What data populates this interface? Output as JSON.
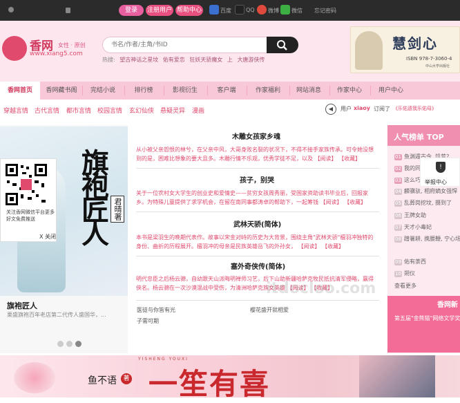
{
  "topbar": {
    "username_placeholder": "",
    "password_placeholder": "",
    "login_label": "登录",
    "register_label": "注册用户",
    "help_label": "帮助中心",
    "baidu_label": "百度",
    "qq_label": "QQ",
    "weibo_label": "微博",
    "wechat_label": "微信",
    "forgot_label": "忘记密码"
  },
  "header": {
    "logo_name": "香网",
    "logo_sub": "女性 · 原创",
    "logo_url": "www.xiang5.com",
    "search_placeholder": "书名/作者/主角/书ID",
    "hot_label": "热搜:",
    "hot_terms": [
      "望古神话之星坟",
      "佑有爱恋",
      "狂妖天骄魔女",
      "上",
      "大唐游侠传"
    ],
    "ad_title": "慧剑心",
    "ad_isbn": "ISBN 978-7-3060-4",
    "ad_publisher": "中山大学出版社"
  },
  "nav": {
    "items": [
      "香网首页",
      "香网藏书阁",
      "完结小说",
      "排行榜",
      "影视衍生",
      "客户端",
      "作家福利",
      "网站消息",
      "作家中心",
      "用户中心"
    ]
  },
  "subnav": {
    "items": [
      "穿越言情",
      "古代言情",
      "都市言情",
      "校园言情",
      "玄幻仙侠",
      "悬疑灵异",
      "漫画"
    ],
    "user_label": "用户",
    "user_name": "xiaoy",
    "subscribed_label": "订阅了",
    "subscribed_book": "《乐佑遗我乐佑母》"
  },
  "showcase": {
    "cover_title": "旗袍匠人",
    "cover_author": "君晴著",
    "qr_caption": "关注香网微信平台更多好文免费推送",
    "qr_close": "X 关闭",
    "book_name": "旗袍匠人",
    "book_desc": "栗盛旗袍百年老店第二代传人盛国华，..."
  },
  "list": [
    {
      "title": "木雕女孩家乡魂",
      "desc": "从小被父亲怨恨的林兮，在父亲中风，大哥身败名裂的状况下，不得不接手家族传承。可令她没想到的是，困难比想象的要大且多。木雕行情不乐观，优秀学徒不足，以及",
      "read": "【阅读】",
      "fav": "【收藏】"
    },
    {
      "title": "孩子，别哭",
      "desc": "关于一位农村女大学生的创业史和爱情史——贫穷女孩周秀丽，受国家资助读书毕业后，回报家乡。为特殊儿童提供了求学机会，在留在南同事都涛卓的帮助下，一起筹钱",
      "read": "【阅读】",
      "fav": "【收藏】"
    },
    {
      "title": "武林天骄(简体)",
      "desc": "本书是梁羽生的晚期代表作。故事以宋金对峙的历史为大背景，围绕主角\"武林天骄\"檀羽冲独特的身份、曲折的历程展开。檀羽冲的母亲是民族英雄岳飞的外孙女，",
      "read": "【阅读】",
      "fav": "【收藏】"
    },
    {
      "title": "塞外奇侠传(简体)",
      "desc": "明代忠臣之后杨云骢，自幼跟天山派晦明禅师习艺，后下山助新疆哈萨克牧民抵抗清军侵略，赢得侠名。杨云骢在一次沙漠混战中受伤，为清洲哈萨克族女英雄",
      "read": "【阅读】",
      "fav": "【收藏】"
    }
  ],
  "minilinks": [
    "医徒与你皆有光",
    "樱花盛开就相爱",
    "子需可期"
  ],
  "rank": {
    "title": "人气榜单 TOP",
    "report_label": "举报中心",
    "items": [
      {
        "n": "01",
        "t": "鱼渊遁古今, 饥荒?"
      },
      {
        "n": "02",
        "t": "我的同事都"
      },
      {
        "n": "03",
        "t": "这么巧, 我"
      },
      {
        "n": "04",
        "t": "麟骥驮, 相府嫡女强悍"
      },
      {
        "n": "05",
        "t": "乱葬岗挖坟, 摄到了"
      },
      {
        "n": "06",
        "t": "王牌女助"
      },
      {
        "n": "07",
        "t": "天才小毒妃"
      },
      {
        "n": "08",
        "t": "蹭暑耕, 携腰鞭, 宁心场"
      },
      {
        "n": "09",
        "t": "佑有荼西"
      },
      {
        "n": "10",
        "t": "朔仪"
      }
    ],
    "more_label": "查看更多",
    "promo_title": "香网新",
    "promo_sub": "第五届\"金熊猫\"网络文学奖"
  },
  "bottom": {
    "author": "鱼不语",
    "author_suffix": "著",
    "title": "一笙有喜",
    "title_sub": "YISHENG YOUXI"
  },
  "watermark": "itdocloo.com",
  "colors": {
    "accent": "#e04a6c",
    "nav_bg": "#f9c8d8",
    "header_bg": "#fde6ee",
    "topbar_bg": "#2b2b2b"
  }
}
